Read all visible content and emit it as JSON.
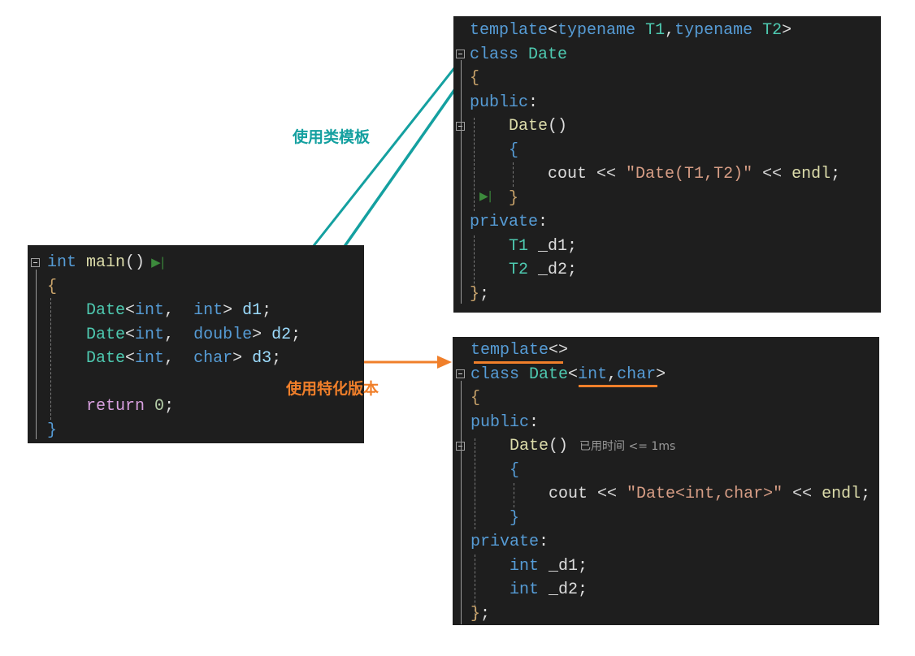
{
  "main_panel": {
    "lines": [
      [
        [
          "int",
          "kw"
        ],
        [
          " ",
          "df"
        ],
        [
          "main",
          "fn"
        ],
        [
          "()",
          "df"
        ],
        [
          "▶|",
          "run"
        ]
      ],
      [
        [
          "{",
          "br"
        ]
      ],
      [
        [
          "    ",
          "df"
        ],
        [
          "Date",
          "ty"
        ],
        [
          "<",
          "df"
        ],
        [
          "int",
          "kw"
        ],
        [
          ",  ",
          "df"
        ],
        [
          "int",
          "kw"
        ],
        [
          "> ",
          "df"
        ],
        [
          "d1",
          "va"
        ],
        [
          ";",
          "df"
        ]
      ],
      [
        [
          "    ",
          "df"
        ],
        [
          "Date",
          "ty"
        ],
        [
          "<",
          "df"
        ],
        [
          "int",
          "kw"
        ],
        [
          ",  ",
          "df"
        ],
        [
          "double",
          "kw"
        ],
        [
          "> ",
          "df"
        ],
        [
          "d2",
          "va"
        ],
        [
          ";",
          "df"
        ]
      ],
      [
        [
          "    ",
          "df"
        ],
        [
          "Date",
          "ty"
        ],
        [
          "<",
          "df"
        ],
        [
          "int",
          "kw"
        ],
        [
          ",  ",
          "df"
        ],
        [
          "char",
          "kw"
        ],
        [
          "> ",
          "df"
        ],
        [
          "d3",
          "va"
        ],
        [
          ";",
          "df"
        ]
      ],
      [
        [
          "",
          "df"
        ]
      ],
      [
        [
          "    ",
          "df"
        ],
        [
          "return",
          "rt"
        ],
        [
          " ",
          "df"
        ],
        [
          "0",
          "nu"
        ],
        [
          ";",
          "df"
        ]
      ],
      [
        [
          "}",
          "kw"
        ]
      ]
    ]
  },
  "template_panel": {
    "lines": [
      [
        [
          "template",
          "kw"
        ],
        [
          "<",
          "df"
        ],
        [
          "typename",
          "kw"
        ],
        [
          " ",
          "df"
        ],
        [
          "T1",
          "ty"
        ],
        [
          ",",
          "df"
        ],
        [
          "typename",
          "kw"
        ],
        [
          " ",
          "df"
        ],
        [
          "T2",
          "ty"
        ],
        [
          ">",
          "df"
        ]
      ],
      [
        [
          "class",
          "kw"
        ],
        [
          " ",
          "df"
        ],
        [
          "Date",
          "ty"
        ]
      ],
      [
        [
          "{",
          "br"
        ]
      ],
      [
        [
          "public",
          "kw"
        ],
        [
          ":",
          "df"
        ]
      ],
      [
        [
          "    ",
          "df"
        ],
        [
          "Date",
          "fn"
        ],
        [
          "()",
          "df"
        ]
      ],
      [
        [
          "    ",
          "df"
        ],
        [
          "{",
          "kw"
        ]
      ],
      [
        [
          "        ",
          "df"
        ],
        [
          "cout",
          "df"
        ],
        [
          " << ",
          "df"
        ],
        [
          "\"Date(T1,T2)\"",
          "st"
        ],
        [
          " << ",
          "df"
        ],
        [
          "endl",
          "fn"
        ],
        [
          ";",
          "df"
        ]
      ],
      [
        [
          "    ",
          "df"
        ],
        [
          "}",
          "br"
        ]
      ],
      [
        [
          "private",
          "kw"
        ],
        [
          ":",
          "df"
        ]
      ],
      [
        [
          "    ",
          "df"
        ],
        [
          "T1",
          "ty"
        ],
        [
          " _d1;",
          "df"
        ]
      ],
      [
        [
          "    ",
          "df"
        ],
        [
          "T2",
          "ty"
        ],
        [
          " _d2;",
          "df"
        ]
      ],
      [
        [
          "}",
          "br"
        ],
        [
          ";",
          "df"
        ]
      ]
    ]
  },
  "special_panel": {
    "lines": [
      [
        [
          "template",
          "kw"
        ],
        [
          "<>",
          "df"
        ]
      ],
      [
        [
          "class",
          "kw"
        ],
        [
          " ",
          "df"
        ],
        [
          "Date",
          "ty"
        ],
        [
          "<",
          "df"
        ],
        [
          "int",
          "kw"
        ],
        [
          ",",
          "df"
        ],
        [
          "char",
          "kw"
        ],
        [
          ">",
          "df"
        ]
      ],
      [
        [
          "{",
          "br"
        ]
      ],
      [
        [
          "public",
          "kw"
        ],
        [
          ":",
          "df"
        ]
      ],
      [
        [
          "    ",
          "df"
        ],
        [
          "Date",
          "fn"
        ],
        [
          "()",
          "df"
        ],
        [
          "已用时间 <= 1ms",
          "hint"
        ]
      ],
      [
        [
          "    ",
          "df"
        ],
        [
          "{",
          "kw"
        ]
      ],
      [
        [
          "        ",
          "df"
        ],
        [
          "cout",
          "df"
        ],
        [
          " << ",
          "df"
        ],
        [
          "\"Date<int,char>\"",
          "st"
        ],
        [
          " << ",
          "df"
        ],
        [
          "endl",
          "fn"
        ],
        [
          ";",
          "df"
        ]
      ],
      [
        [
          "    ",
          "df"
        ],
        [
          "}",
          "kw"
        ]
      ],
      [
        [
          "private",
          "kw"
        ],
        [
          ":",
          "df"
        ]
      ],
      [
        [
          "    ",
          "df"
        ],
        [
          "int",
          "kw"
        ],
        [
          " _d1;",
          "df"
        ]
      ],
      [
        [
          "    ",
          "df"
        ],
        [
          "int",
          "kw"
        ],
        [
          " _d2;",
          "df"
        ]
      ],
      [
        [
          "}",
          "br"
        ],
        [
          ";",
          "df"
        ]
      ]
    ]
  },
  "annotations": {
    "use_class_template": "使用类模板",
    "use_specialization": "使用特化版本"
  },
  "colors": {
    "teal_arrow": "#14a0a0",
    "orange_arrow": "#f07f2a",
    "editor_bg": "#1e1e1e"
  }
}
